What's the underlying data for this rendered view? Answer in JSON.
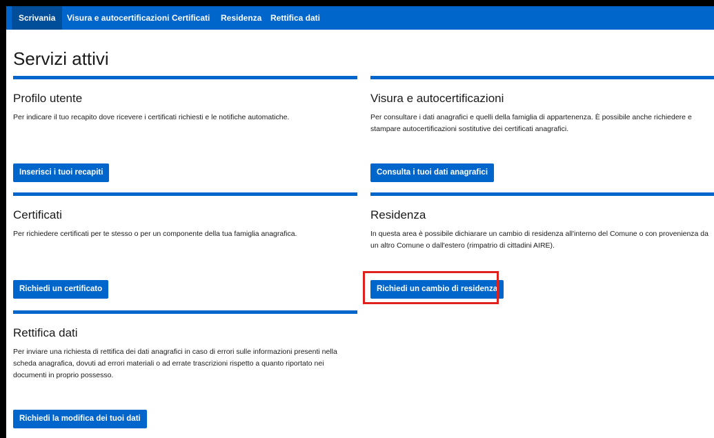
{
  "nav": {
    "items": [
      {
        "label": "Scrivania",
        "active": true
      },
      {
        "label": "Visura e autocertificazioni",
        "active": false
      },
      {
        "label": "Certificati",
        "active": false
      },
      {
        "label": "Residenza",
        "active": false
      },
      {
        "label": "Rettifica dati",
        "active": false
      }
    ]
  },
  "page": {
    "title": "Servizi attivi"
  },
  "cards": {
    "profilo": {
      "title": "Profilo utente",
      "description": "Per indicare il tuo recapito dove ricevere i certificati richiesti e le notifiche automatiche.",
      "button": "Inserisci i tuoi recapiti"
    },
    "visura": {
      "title": "Visura e autocertificazioni",
      "description": "Per consultare i dati anagrafici e quelli della famiglia di appartenenza. È possibile anche richiedere e stampare autocertificazioni sostitutive dei certificati anagrafici.",
      "button": "Consulta i tuoi dati anagrafici"
    },
    "certificati": {
      "title": "Certificati",
      "description": "Per richiedere certificati per te stesso o per un componente della tua famiglia anagrafica.",
      "button": "Richiedi un certificato"
    },
    "residenza": {
      "title": "Residenza",
      "description": "In questa area è possibile dichiarare un cambio di residenza all'interno del Comune o con provenienza da un altro Comune o dall'estero (rimpatrio di cittadini AIRE).",
      "button": "Richiedi un cambio di residenza"
    },
    "rettifica": {
      "title": "Rettifica dati",
      "description": "Per inviare una richiesta di rettifica dei dati anagrafici in caso di errori sulle informazioni presenti nella scheda anagrafica, dovuti ad errori materiali o ad errate trascrizioni rispetto a quanto riportato nei documenti in proprio possesso.",
      "button": "Richiedi la modifica dei tuoi dati"
    }
  },
  "colors": {
    "primary": "#0066cc",
    "primary_active": "#004d99",
    "highlight": "#e0201c"
  }
}
